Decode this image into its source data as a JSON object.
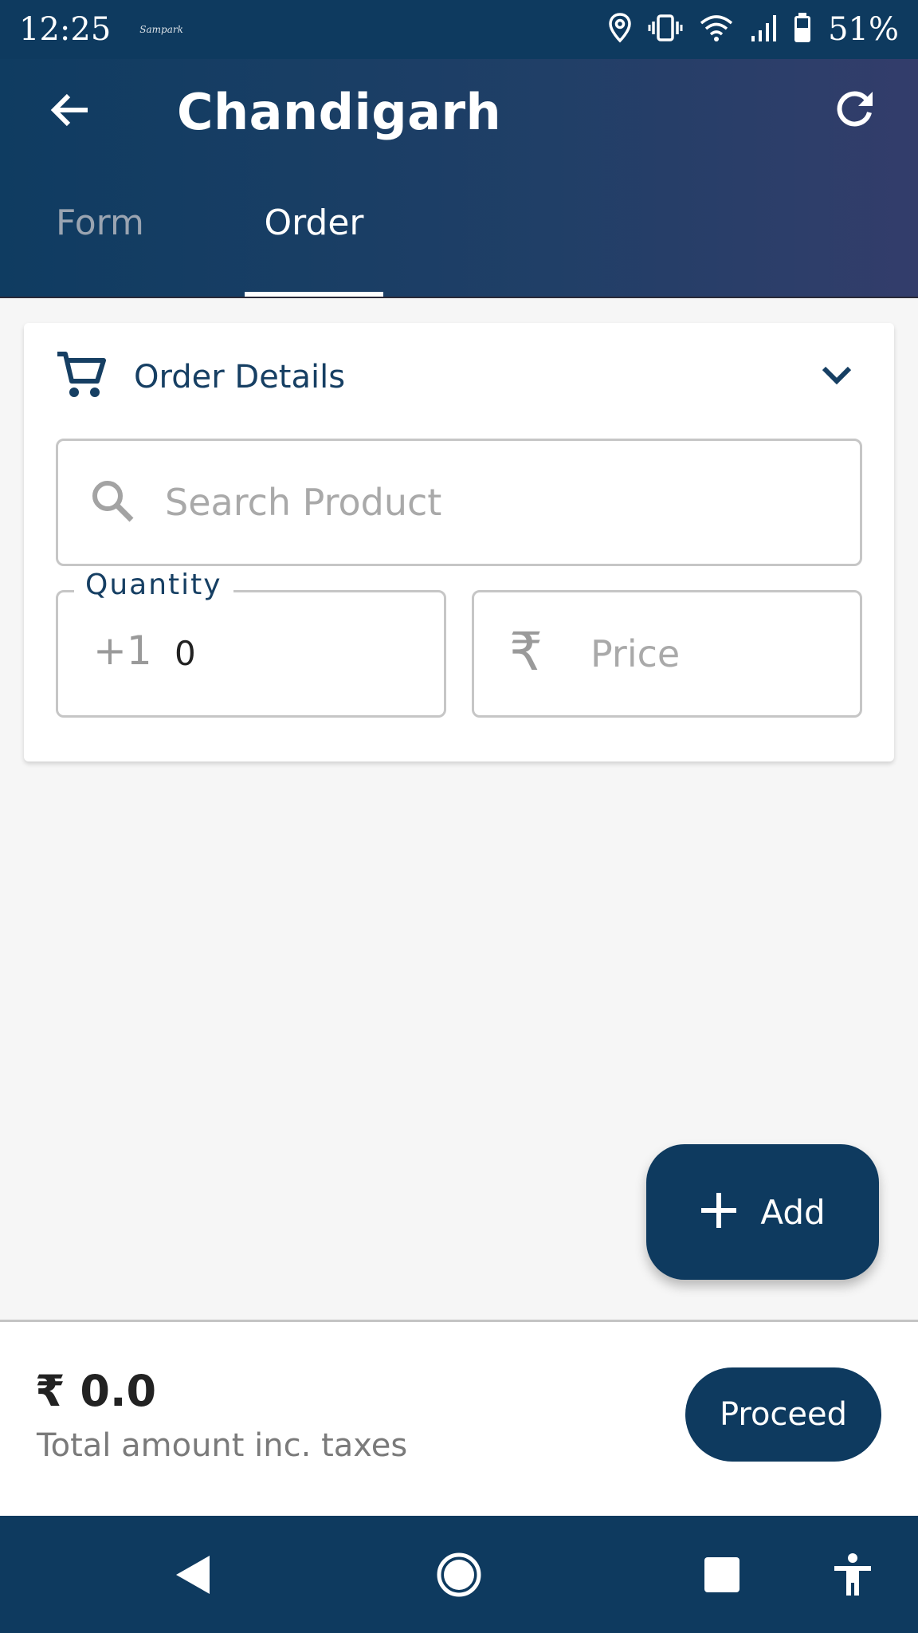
{
  "status_bar": {
    "time": "12:25",
    "carrier_label": "Sampark",
    "battery_percent": "51%",
    "icons": [
      "location-icon",
      "vibrate-icon",
      "wifi-icon",
      "signal-icon",
      "battery-icon"
    ]
  },
  "header": {
    "title": "Chandigarh",
    "back_icon": "arrow-left-icon",
    "refresh_icon": "refresh-icon"
  },
  "tabs": [
    {
      "label": "Form",
      "selected": false
    },
    {
      "label": "Order",
      "selected": true
    }
  ],
  "order_card": {
    "title": "Order Details",
    "icon": "cart-icon",
    "expanded_icon": "chevron-down-icon",
    "search": {
      "placeholder": "Search Product"
    },
    "quantity": {
      "label": "Quantity",
      "increment_text": "+1",
      "value": "0"
    },
    "price": {
      "currency_symbol": "₹",
      "placeholder": "Price"
    }
  },
  "fab": {
    "label": "Add",
    "icon": "plus-icon"
  },
  "footer": {
    "total": "₹ 0.0",
    "caption": "Total amount inc. taxes",
    "proceed_label": "Proceed"
  },
  "colors": {
    "primary": "#0e3a5f",
    "header_gradient_end": "#333d6b",
    "background": "#f6f6f6"
  },
  "nav_bar": {
    "icons": [
      "back-triangle-icon",
      "home-circle-icon",
      "recents-square-icon",
      "accessibility-icon"
    ]
  }
}
